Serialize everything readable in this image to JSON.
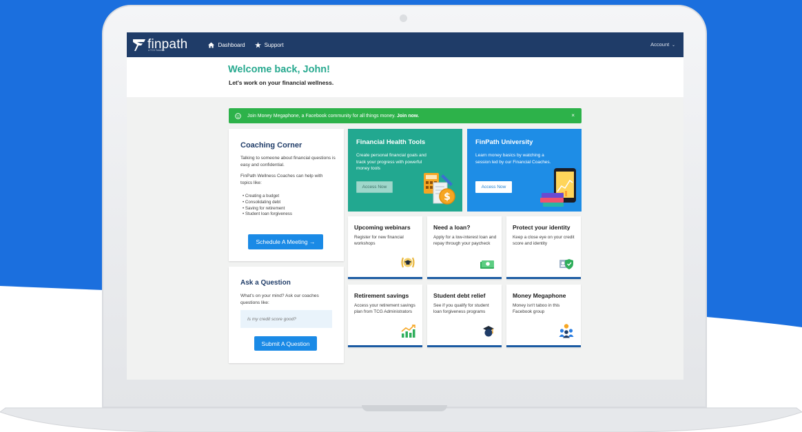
{
  "colors": {
    "brand_navy": "#1f3c68",
    "teal": "#27a98f",
    "banner_green": "#2db24a",
    "blue": "#1a8ae6",
    "page_blue": "#1b6fde"
  },
  "nav": {
    "logo": "finpath",
    "logo_sub": "a TCG Solution",
    "dashboard": "Dashboard",
    "support": "Support",
    "account": "Account"
  },
  "hero": {
    "welcome": "Welcome back, John!",
    "subline": "Let's work on your financial wellness."
  },
  "banner": {
    "text": "Join Money Megaphone, a Facebook community for all things money.",
    "cta": "Join now.",
    "close": "×"
  },
  "coaching": {
    "title": "Coaching Corner",
    "p1": "Talking to someone about financial questions is easy and confidential.",
    "p2": "FinPath Wellness Coaches can help with topics like:",
    "topics": [
      "Creating a budget",
      "Consolidating debt",
      "Saving for retirement",
      "Student loan forgiveness"
    ],
    "button": "Schedule A Meeting →"
  },
  "ask": {
    "title": "Ask a Question",
    "text": "What's on your mind? Ask our coaches questions like:",
    "placeholder": "Is my credit score good?",
    "button": "Submit A Question"
  },
  "promos": [
    {
      "title": "Financial Health Tools",
      "text": "Create personal financial goals and track your progress with powerful money tools",
      "button": "Access Now",
      "icon": "calculator-coin-icon"
    },
    {
      "title": "FinPath University",
      "text": "Learn money basics by watching a session led by our Financial Coaches.",
      "button": "Access Now",
      "icon": "tablet-books-icon"
    }
  ],
  "tiles": [
    {
      "title": "Upcoming webinars",
      "text": "Register for new financial workshops",
      "icon": "graduation-award-icon"
    },
    {
      "title": "Need a loan?",
      "text": "Apply for a low-interest loan and repay through your paycheck",
      "icon": "cash-icon"
    },
    {
      "title": "Protect your identity",
      "text": "Keep a close eye on your credit score and identity",
      "icon": "id-shield-icon"
    },
    {
      "title": "Retirement savings",
      "text": "Access your retirement savings plan from TCG Administrators",
      "icon": "growth-chart-icon"
    },
    {
      "title": "Student debt relief",
      "text": "See if you qualify for student loan forgiveness programs",
      "icon": "graduate-head-icon"
    },
    {
      "title": "Money Megaphone",
      "text": "Money isn't taboo in this Facebook group",
      "icon": "community-icon"
    }
  ]
}
